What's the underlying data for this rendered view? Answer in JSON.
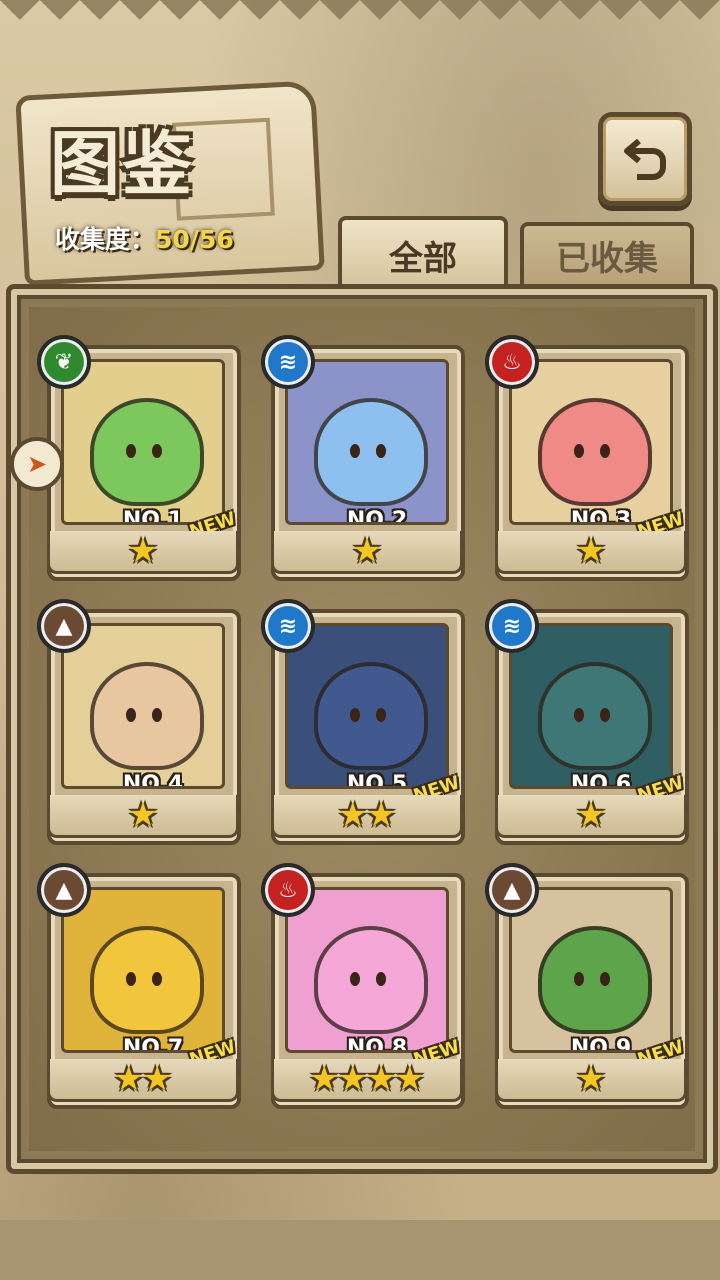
{
  "header": {
    "title": "图鉴",
    "collection_label": "收集度：",
    "collection_value": "50/56",
    "back_icon": "return-arrow-icon"
  },
  "tabs": [
    {
      "label": "全部",
      "active": true
    },
    {
      "label": "已收集",
      "active": false
    }
  ],
  "colors": {
    "grass": "#2f8a2f",
    "water": "#1f78c9",
    "fire": "#c42121",
    "earth": "#6b4a34",
    "star": "#f4c525",
    "new_badge": "#f6dd49"
  },
  "cards": [
    {
      "no": "NO.1",
      "element": "grass",
      "element_icon": "leaf-icon",
      "stars": 1,
      "new": "NEW",
      "body_color": "#7cc85d",
      "bg": "#e3cf8d"
    },
    {
      "no": "NO.2",
      "element": "water",
      "element_icon": "water-wave-icon",
      "stars": 1,
      "new": "",
      "body_color": "#8ec0ef",
      "bg": "#8b93c9"
    },
    {
      "no": "NO.3",
      "element": "fire",
      "element_icon": "flame-icon",
      "stars": 1,
      "new": "NEW",
      "body_color": "#ef8a86",
      "bg": "#e6d0a0"
    },
    {
      "no": "NO.4",
      "element": "earth",
      "element_icon": "mountain-icon",
      "stars": 1,
      "new": "",
      "body_color": "#e8c7a0",
      "bg": "#e4cf98"
    },
    {
      "no": "NO.5",
      "element": "water",
      "element_icon": "water-wave-icon",
      "stars": 2,
      "new": "NEW",
      "body_color": "#41598f",
      "bg": "#3a4f7a"
    },
    {
      "no": "NO.6",
      "element": "water",
      "element_icon": "water-wave-icon",
      "stars": 1,
      "new": "NEW",
      "body_color": "#3f7776",
      "bg": "#2f5f63"
    },
    {
      "no": "NO.7",
      "element": "earth",
      "element_icon": "mountain-icon",
      "stars": 2,
      "new": "NEW",
      "body_color": "#f2c63c",
      "bg": "#e0b33a"
    },
    {
      "no": "NO.8",
      "element": "fire",
      "element_icon": "flame-icon",
      "stars": 4,
      "new": "NEW",
      "body_color": "#f5a7d8",
      "bg": "#ef9fd0"
    },
    {
      "no": "NO.9",
      "element": "earth",
      "element_icon": "mountain-icon",
      "stars": 1,
      "new": "NEW",
      "body_color": "#5ea44a",
      "bg": "#d7c2a0"
    }
  ]
}
